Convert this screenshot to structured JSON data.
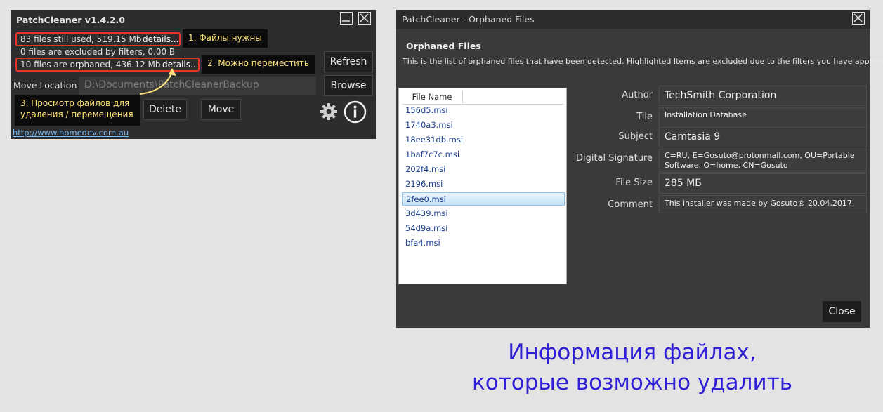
{
  "main_window": {
    "title": "PatchCleaner v1.4.2.0",
    "stats": {
      "still_used": "83 files still used, 519.15 Mb",
      "excluded": "0 files are excluded by filters, 0.00 B",
      "orphaned": "10 files are orphaned, 436.12 Mb",
      "details_label": "details..."
    },
    "move_location_label": "Move Location",
    "move_location_value": "D:\\Documents\\PatchCleanerBackup",
    "buttons": {
      "refresh": "Refresh",
      "browse": "Browse",
      "delete": "Delete",
      "move": "Move"
    },
    "website": "http://www.homedev.com.au"
  },
  "callouts": {
    "c1": "1. Файлы нужны",
    "c2": "2. Можно переместить",
    "c3_line1": "3. Просмотр файлов для",
    "c3_line2": "удаления / перемещения"
  },
  "orphaned_dialog": {
    "title": "PatchCleaner - Orphaned Files",
    "heading": "Orphaned Files",
    "description": "This is the list of orphaned files that have been detected. Highlighted Items are excluded due to the filters you have applied",
    "list_header": "File Name",
    "files": [
      "156d5.msi",
      "1740a3.msi",
      "18ee31db.msi",
      "1baf7c7c.msi",
      "202f4.msi",
      "2196.msi",
      "2fee0.msi",
      "3d439.msi",
      "54d9a.msi",
      "bfa4.msi"
    ],
    "selected_file": "2fee0.msi",
    "properties": [
      {
        "label": "Author",
        "value": "TechSmith Corporation"
      },
      {
        "label": "Tile",
        "value": "Installation Database"
      },
      {
        "label": "Subject",
        "value": "Camtasia 9"
      },
      {
        "label": "Digital Signature",
        "value": "C=RU, E=Gosuto@protonmail.com, OU=Portable Software, O=home, CN=Gosuto"
      },
      {
        "label": "File Size",
        "value": "285 МБ"
      },
      {
        "label": "Comment",
        "value": "This installer was made by Gosuto® 20.04.2017."
      }
    ],
    "close_label": "Close"
  },
  "caption": {
    "line1": "Информация файлах,",
    "line2": "которые возможно удалить"
  },
  "colors": {
    "annotation_red": "#e8342a",
    "callout_text": "#ffe47a",
    "caption_blue": "#2f1fd6",
    "selection": "#c6e4f8"
  }
}
